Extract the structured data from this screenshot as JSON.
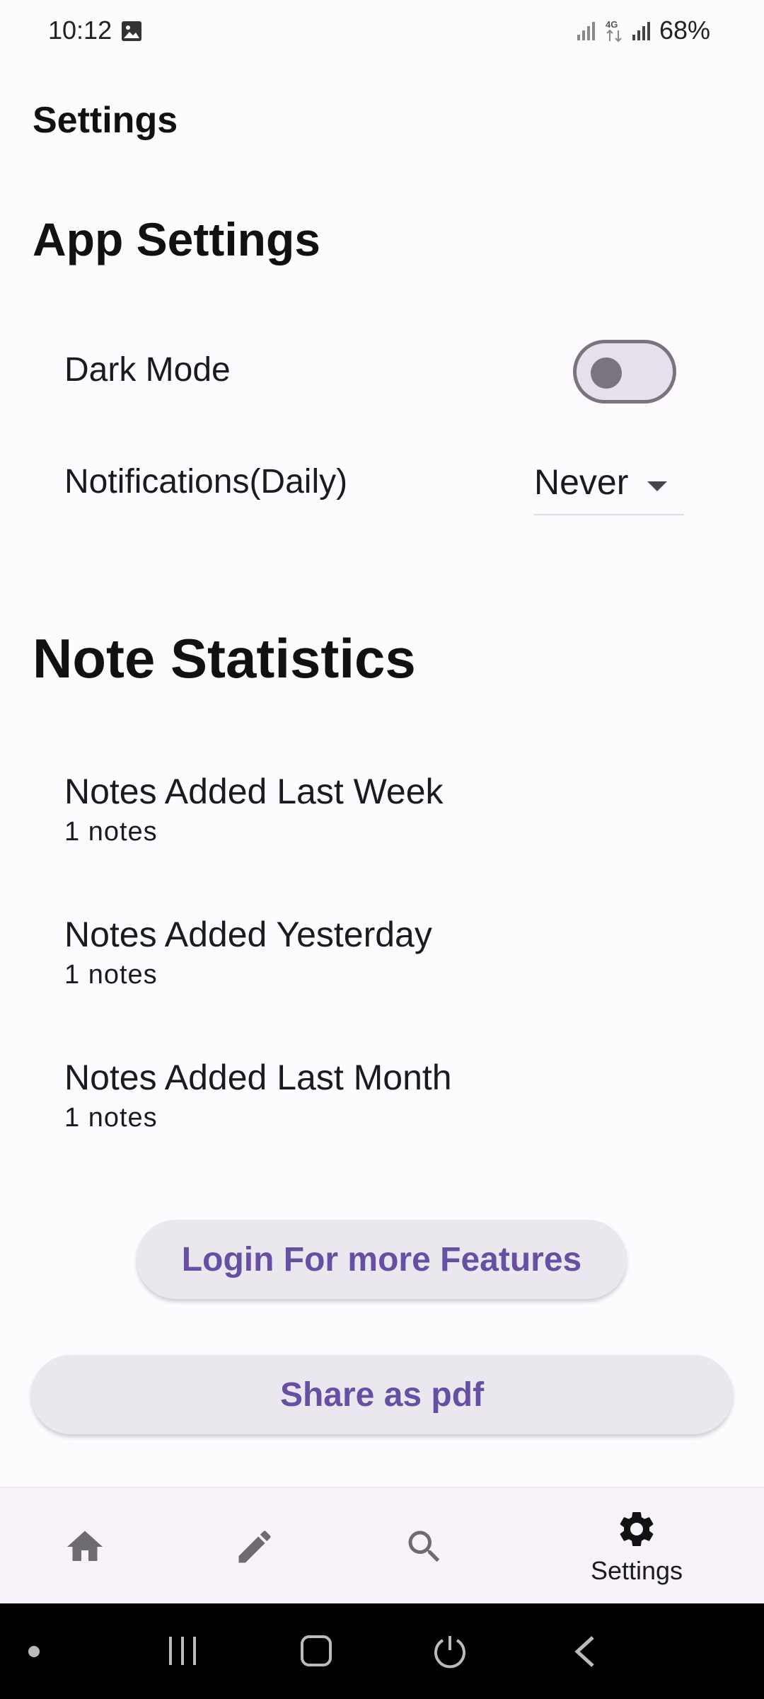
{
  "status_bar": {
    "time": "10:12",
    "network": "4G",
    "battery": "68%"
  },
  "app": {
    "title": "Settings"
  },
  "app_settings": {
    "heading": "App Settings",
    "dark_mode": {
      "label": "Dark Mode",
      "enabled": false
    },
    "notifications": {
      "label": "Notifications(Daily)",
      "selected": "Never"
    }
  },
  "note_statistics": {
    "heading": "Note Statistics",
    "items": [
      {
        "label": "Notes Added Last Week",
        "value": "1 notes"
      },
      {
        "label": "Notes Added Yesterday",
        "value": "1 notes"
      },
      {
        "label": "Notes Added Last Month",
        "value": "1 notes"
      }
    ]
  },
  "actions": {
    "login_label": "Login For more Features",
    "share_label": "Share as pdf"
  },
  "bottom_nav": {
    "items": [
      {
        "icon": "home-icon"
      },
      {
        "icon": "edit-icon"
      },
      {
        "icon": "search-icon"
      },
      {
        "icon": "gear-icon",
        "label": "Settings",
        "active": true
      }
    ]
  },
  "colors": {
    "accent": "#6750a4",
    "button_bg": "#eae7ef",
    "toggle_outline": "#79747e"
  }
}
